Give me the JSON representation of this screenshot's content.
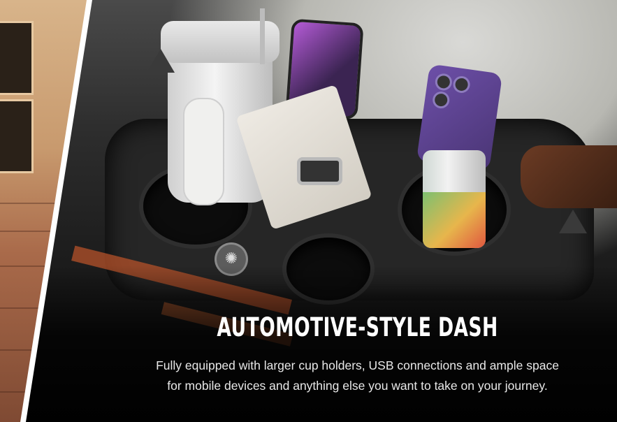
{
  "slide": {
    "title": "AUTOMOTIVE-STYLE DASH",
    "description_line1": "Fully equipped with larger cup holders, USB connections and ample space",
    "description_line2": "for mobile devices and anything else you want to take on your journey."
  },
  "icons": {
    "badge": "yamaha-logo-icon"
  },
  "colors": {
    "title_text": "#ffffff",
    "body_text": "#e8e8e8",
    "slide_divider": "#ffffff",
    "warning_label": "#b5522a"
  }
}
